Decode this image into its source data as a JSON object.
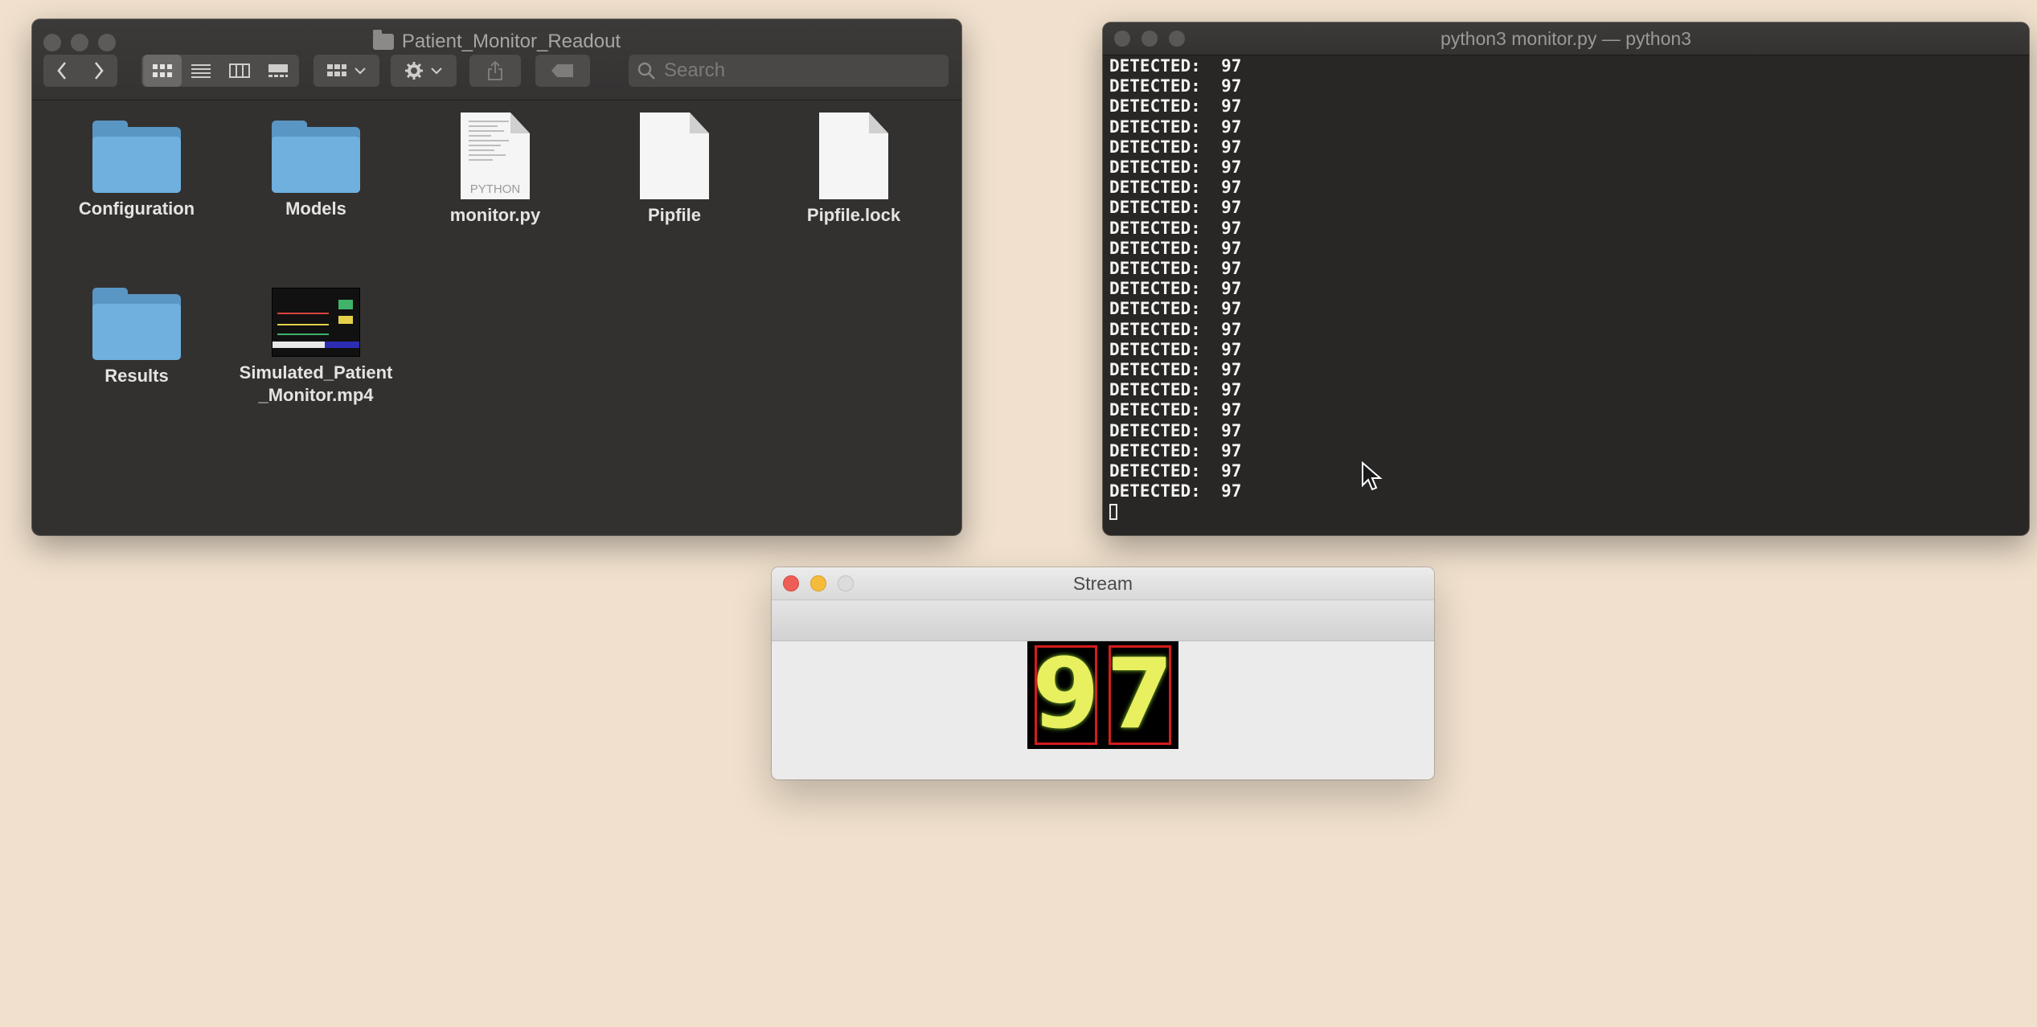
{
  "finder": {
    "title": "Patient_Monitor_Readout",
    "search_placeholder": "Search",
    "items": [
      {
        "label": "Configuration",
        "kind": "folder"
      },
      {
        "label": "Models",
        "kind": "folder"
      },
      {
        "label": "monitor.py",
        "kind": "python-file",
        "tag": "PYTHON"
      },
      {
        "label": "Pipfile",
        "kind": "document"
      },
      {
        "label": "Pipfile.lock",
        "kind": "document"
      },
      {
        "label": "Results",
        "kind": "folder"
      },
      {
        "label": "Simulated_Patient\n_Monitor.mp4",
        "kind": "video"
      }
    ]
  },
  "terminal": {
    "title": "python3 monitor.py — python3",
    "output": "DETECTED:  97\nDETECTED:  97\nDETECTED:  97\nDETECTED:  97\nDETECTED:  97\nDETECTED:  97\nDETECTED:  97\nDETECTED:  97\nDETECTED:  97\nDETECTED:  97\nDETECTED:  97\nDETECTED:  97\nDETECTED:  97\nDETECTED:  97\nDETECTED:  97\nDETECTED:  97\nDETECTED:  97\nDETECTED:  97\nDETECTED:  97\nDETECTED:  97\nDETECTED:  97\nDETECTED:  97\n"
  },
  "stream": {
    "title": "Stream",
    "digits": [
      "9",
      "7"
    ]
  },
  "colors": {
    "desktop": "#f0e0cd",
    "close": "#ee5e56",
    "minimize": "#f5bc3b",
    "folder": "#6fb0de",
    "digit": "#e9f060",
    "box": "#d41c1c"
  }
}
